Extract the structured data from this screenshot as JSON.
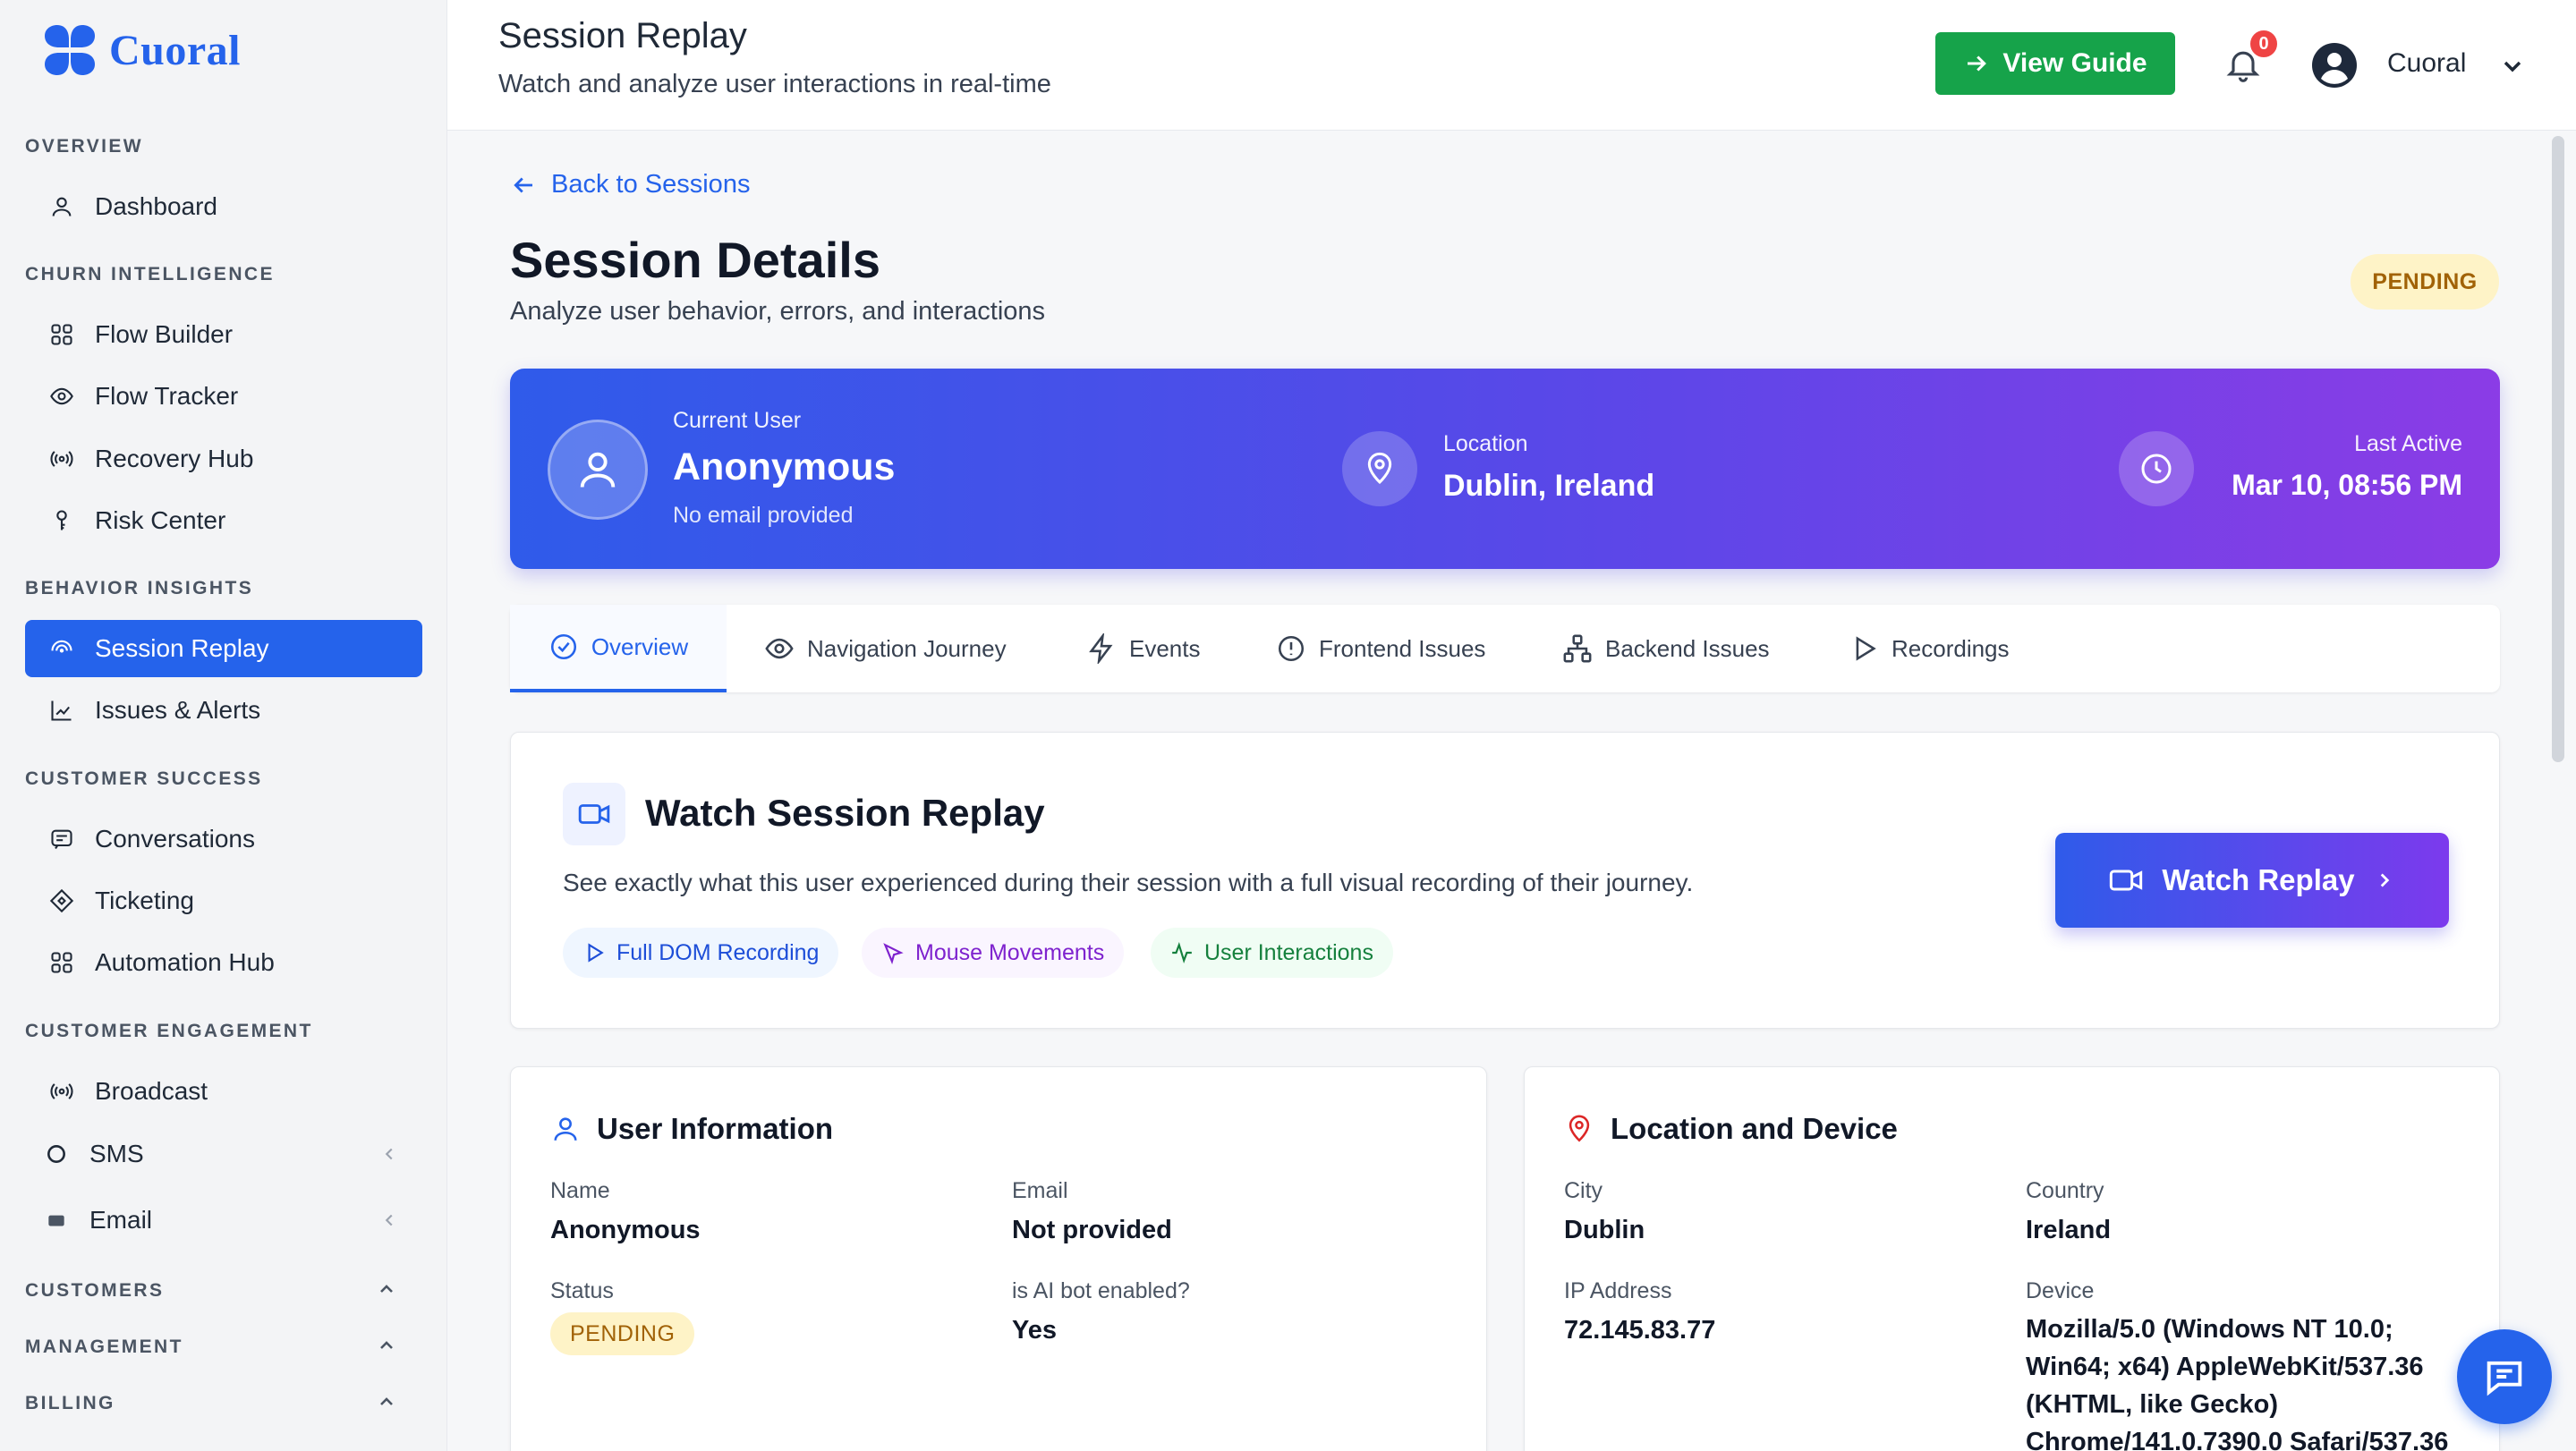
{
  "brand": {
    "name": "Cuoral",
    "color": "#2563eb"
  },
  "sidebar": {
    "sections": [
      {
        "label": "OVERVIEW"
      },
      {
        "label": "CHURN INTELLIGENCE"
      },
      {
        "label": "BEHAVIOR INSIGHTS"
      },
      {
        "label": "CUSTOMER SUCCESS"
      },
      {
        "label": "CUSTOMER ENGAGEMENT"
      },
      {
        "label": "CUSTOMERS"
      },
      {
        "label": "MANAGEMENT"
      },
      {
        "label": "BILLING"
      }
    ],
    "items": [
      {
        "label": "Dashboard",
        "icon": "user-icon"
      },
      {
        "label": "Flow Builder",
        "icon": "grid-icon"
      },
      {
        "label": "Flow Tracker",
        "icon": "eye-icon"
      },
      {
        "label": "Recovery Hub",
        "icon": "broadcast-icon"
      },
      {
        "label": "Risk Center",
        "icon": "key-icon"
      },
      {
        "label": "Session Replay",
        "icon": "replay-icon",
        "active": true
      },
      {
        "label": "Issues & Alerts",
        "icon": "chart-icon"
      },
      {
        "label": "Conversations",
        "icon": "message-icon"
      },
      {
        "label": "Ticketing",
        "icon": "ticket-icon"
      },
      {
        "label": "Automation Hub",
        "icon": "grid-icon"
      },
      {
        "label": "Broadcast",
        "icon": "broadcast-icon"
      },
      {
        "label": "SMS",
        "icon": "circle-icon"
      },
      {
        "label": "Email",
        "icon": "mail-icon"
      }
    ]
  },
  "header": {
    "title": "Session Replay",
    "subtitle": "Watch and analyze user interactions in real-time",
    "guide_label": "View Guide",
    "notification_count": "0",
    "user_name": "Cuoral"
  },
  "main": {
    "back_label": "Back to Sessions",
    "title": "Session Details",
    "subtitle": "Analyze user behavior, errors, and interactions",
    "status": "PENDING",
    "hero": {
      "user_label": "Current User",
      "user_name": "Anonymous",
      "user_email": "No email provided",
      "location_label": "Location",
      "location": "Dublin, Ireland",
      "last_active_label": "Last Active",
      "last_active": "Mar 10, 08:56 PM"
    },
    "tabs": [
      {
        "label": "Overview",
        "active": true
      },
      {
        "label": "Navigation Journey"
      },
      {
        "label": "Events"
      },
      {
        "label": "Frontend Issues"
      },
      {
        "label": "Backend Issues"
      },
      {
        "label": "Recordings"
      }
    ],
    "watch": {
      "title": "Watch Session Replay",
      "description": "See exactly what this user experienced during their session with a full visual recording of their journey.",
      "chips": [
        "Full DOM Recording",
        "Mouse Movements",
        "User Interactions"
      ],
      "button_label": "Watch Replay"
    },
    "user_info": {
      "title": "User Information",
      "name_label": "Name",
      "name": "Anonymous",
      "email_label": "Email",
      "email": "Not provided",
      "status_label": "Status",
      "status": "PENDING",
      "ai_label": "is AI bot enabled?",
      "ai_value": "Yes"
    },
    "location_device": {
      "title": "Location and Device",
      "city_label": "City",
      "city": "Dublin",
      "country_label": "Country",
      "country": "Ireland",
      "ip_label": "IP Address",
      "ip": "72.145.83.77",
      "device_label": "Device",
      "device": "Mozilla/5.0 (Windows NT 10.0; Win64; x64) AppleWebKit/537.36 (KHTML, like Gecko) Chrome/141.0.7390.0 Safari/537.36"
    }
  },
  "colors": {
    "primary": "#2563eb",
    "success": "#16a34a",
    "pending_bg": "#fef3c7",
    "pending_text": "#a16207",
    "hero_start": "#2f5bea",
    "hero_end": "#8b3ce6"
  }
}
